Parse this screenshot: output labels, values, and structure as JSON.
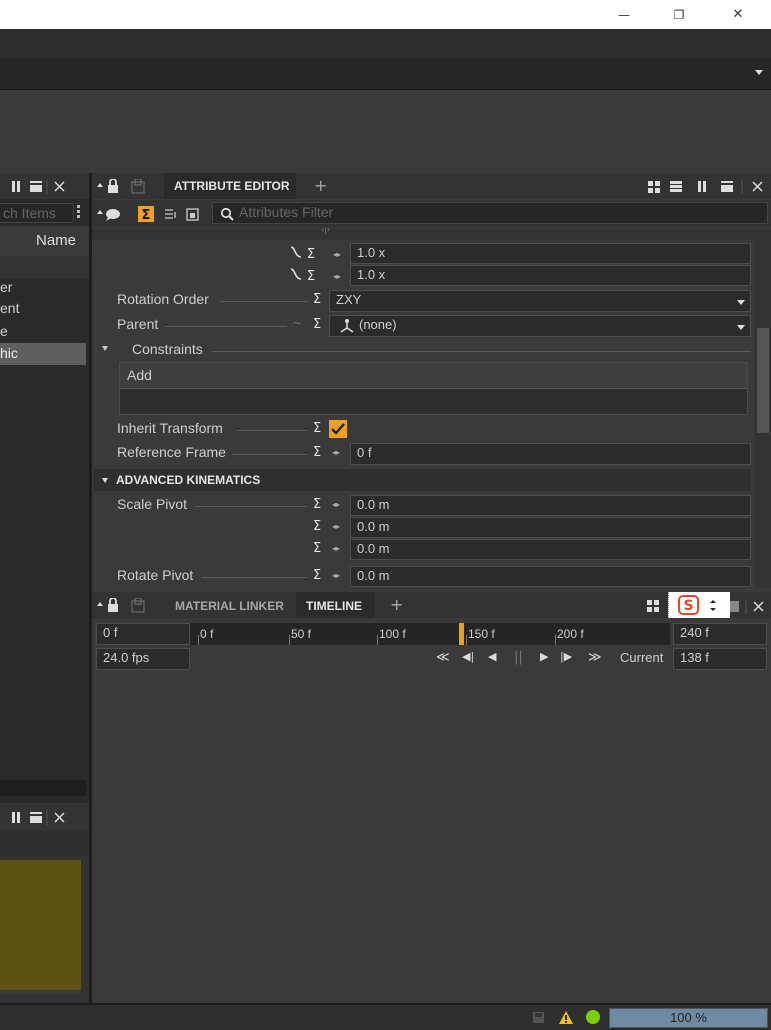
{
  "window": {
    "minimize_glyph": "—",
    "restore_glyph": "❐",
    "close_glyph": "✕"
  },
  "left_panel": {
    "search_placeholder": "ch Items",
    "column_name": "Name",
    "items": [
      "er",
      "ent",
      "e",
      "hic"
    ]
  },
  "attribute_editor": {
    "tab_label": "ATTRIBUTE EDITOR",
    "add_tab": "+",
    "filter_placeholder": "Attributes Filter",
    "sigma": "Σ",
    "scale_values": [
      "1.0 x",
      "1.0 x"
    ],
    "rotation_order_label": "Rotation Order",
    "rotation_order_value": "ZXY",
    "parent_label": "Parent",
    "parent_value": "(none)",
    "constraints_label": "Constraints",
    "add_label": "Add",
    "inherit_transform_label": "Inherit Transform",
    "reference_frame_label": "Reference Frame",
    "reference_frame_value": "0 f",
    "advanced_kinematics_label": "ADVANCED KINEMATICS",
    "scale_pivot_label": "Scale Pivot",
    "scale_pivot_values": [
      "0.0 m",
      "0.0 m",
      "0.0 m"
    ],
    "rotate_pivot_label": "Rotate Pivot",
    "rotate_pivot_value": "0.0 m"
  },
  "timeline": {
    "tab_material_linker": "MATERIAL LINKER",
    "tab_timeline": "TIMELINE",
    "add_tab": "+",
    "start_frame": "0 f",
    "end_frame": "240 f",
    "fps": "24.0 fps",
    "ruler_labels": [
      "0 f",
      "50 f",
      "100 f",
      "150 f",
      "200 f"
    ],
    "current_label": "Current",
    "current_value": "138 f",
    "transport": [
      "≪",
      "◀|",
      "◀",
      "||",
      "▶",
      "|▶",
      "≫"
    ]
  },
  "status": {
    "zoom": "100 %",
    "zoom_fill": 1.0
  },
  "colors": {
    "accent": "#f0a020",
    "ok": "#7ad00a",
    "warn": "#f2c40f",
    "ime_red": "#e8452c",
    "swatch": "#5c5213"
  }
}
